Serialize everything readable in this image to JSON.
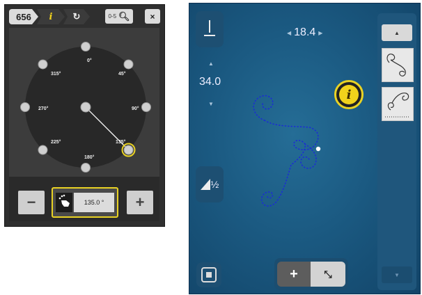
{
  "stitch_selector": {
    "stitch_number": "656",
    "info_symbol": "i",
    "refresh_symbol": "↻",
    "zoom_label": "0-5",
    "close_symbol": "×",
    "angles": [
      "0°",
      "45°",
      "90°",
      "135°",
      "180°",
      "225°",
      "270°",
      "315°"
    ],
    "selected_angle": "135°",
    "minus_label": "−",
    "plus_label": "+",
    "angle_value": "135.0 °",
    "accent_color": "#e9d224"
  },
  "editor": {
    "stitch_width": "18.4",
    "stitch_length": "34.0",
    "info_symbol": "i",
    "plus_label": "+",
    "move_symbol": "⤡",
    "scroll_up_symbol": "▲",
    "scroll_down_symbol": "▼",
    "balance_label": "½",
    "stitch_color": "#1b2bd6",
    "accent_color": "#e9d224"
  }
}
